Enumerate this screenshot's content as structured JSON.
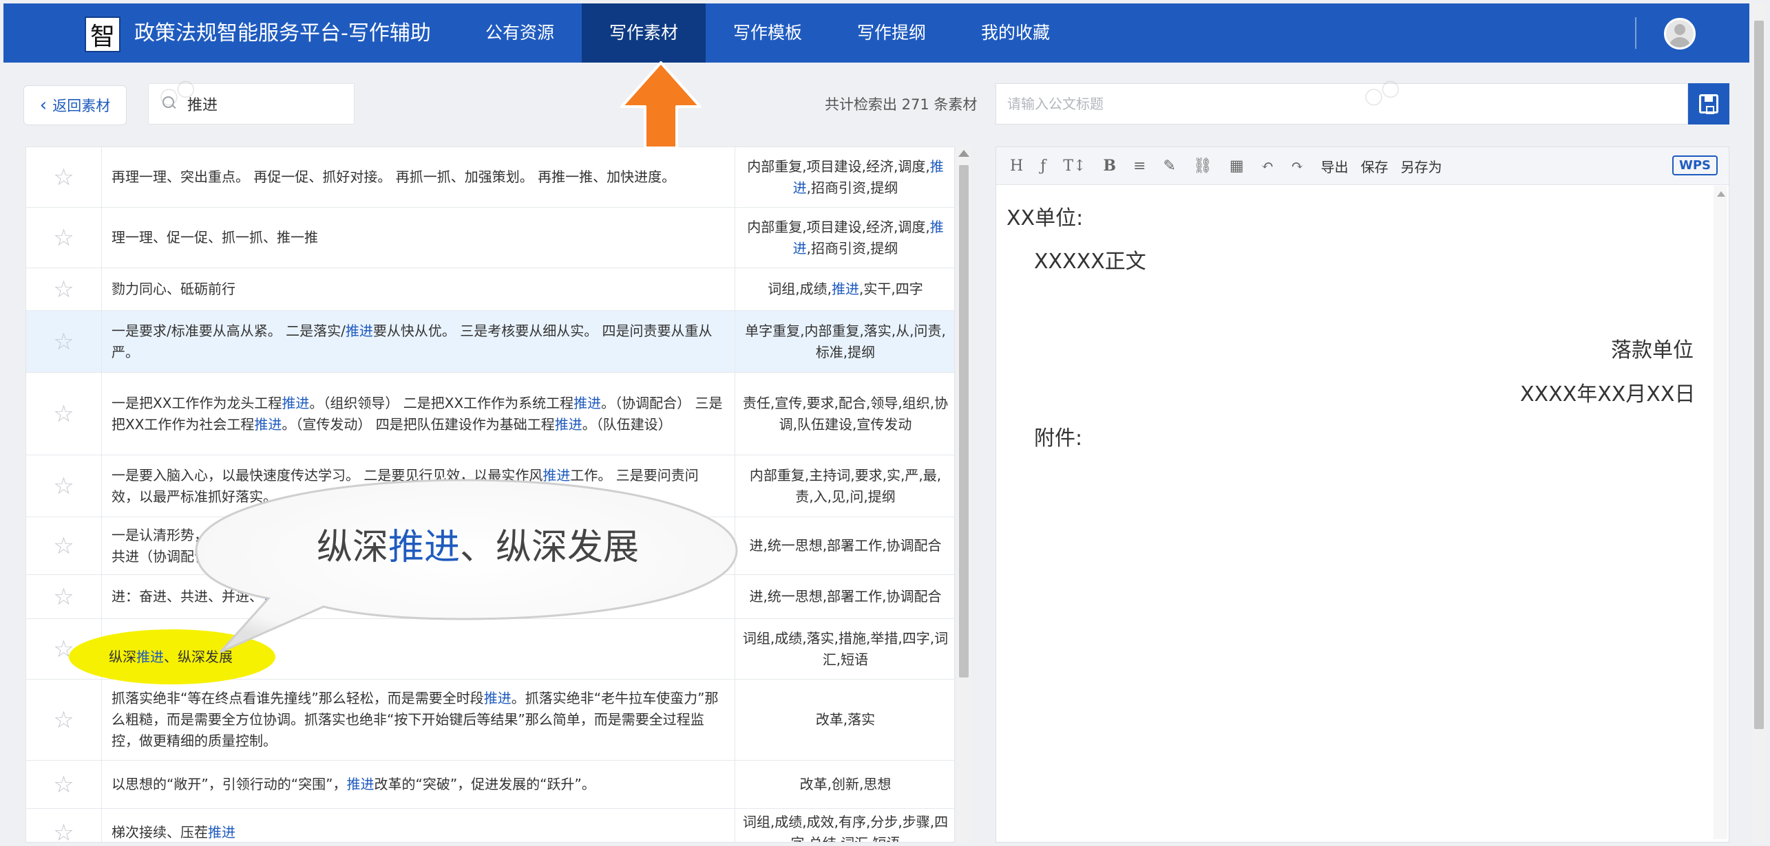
{
  "header": {
    "logo_char": "智",
    "title": "政策法规智能服务平台-写作辅助",
    "tabs": [
      {
        "label": "公有资源",
        "active": false
      },
      {
        "label": "写作素材",
        "active": true
      },
      {
        "label": "写作模板",
        "active": false
      },
      {
        "label": "写作提纲",
        "active": false
      },
      {
        "label": "我的收藏",
        "active": false
      }
    ]
  },
  "toolbar": {
    "back_label": "返回素材",
    "search_value": "推进",
    "result_count": "共计检索出 271 条素材",
    "title_placeholder": "请输入公文标题"
  },
  "materials": [
    {
      "segments": [
        {
          "t": "再理一理、突出重点。 再促一促、抓好对接。 再抓一抓、加强策划。 再推一推、加快进度。"
        }
      ],
      "tags": [
        {
          "t": "内部重复,项目建设,经济,调度,"
        },
        {
          "t": "推进",
          "hl": true
        },
        {
          "t": ",招商引资,提纲"
        }
      ],
      "starred": false
    },
    {
      "segments": [
        {
          "t": "理一理、促一促、抓一抓、推一推"
        }
      ],
      "tags": [
        {
          "t": "内部重复,项目建设,经济,调度,"
        },
        {
          "t": "推进",
          "hl": true
        },
        {
          "t": ",招商引资,提纲"
        }
      ],
      "starred": false
    },
    {
      "segments": [
        {
          "t": "勠力同心、砥砺前行"
        }
      ],
      "tags": [
        {
          "t": "词组,成绩,"
        },
        {
          "t": "推进",
          "hl": true
        },
        {
          "t": ",实干,四字"
        }
      ],
      "starred": false
    },
    {
      "segments": [
        {
          "t": "一是要求/标准要从高从紧。 二是落实/"
        },
        {
          "t": "推进",
          "hl": true
        },
        {
          "t": "要从快从优。 三是考核要从细从实。 四是问责要从重从严。"
        }
      ],
      "tags": [
        {
          "t": "单字重复,内部重复,落实,从,问责,标准,提纲"
        }
      ],
      "starred": false,
      "highlighted": true
    },
    {
      "segments": [
        {
          "t": "一是把XX工作作为龙头工程"
        },
        {
          "t": "推进",
          "hl": true
        },
        {
          "t": "。（组织领导） 二是把XX工作作为系统工程"
        },
        {
          "t": "推进",
          "hl": true
        },
        {
          "t": "。（协调配合） 三是把XX工作作为社会工程"
        },
        {
          "t": "推进",
          "hl": true
        },
        {
          "t": "。（宣传发动） 四是把队伍建设作为基础工程"
        },
        {
          "t": "推进",
          "hl": true
        },
        {
          "t": "。（队伍建设）"
        }
      ],
      "tags": [
        {
          "t": "责任,宣传,要求,配合,领导,组织,协调,队伍建设,宣传发动"
        }
      ],
      "starred": false
    },
    {
      "segments": [
        {
          "t": "一是要入脑入心，以最快速度传达学习。 二是要见行见效，以最实作风"
        },
        {
          "t": "推进",
          "hl": true
        },
        {
          "t": "工作。 三是要问责问效，以最严标准抓好落实。"
        }
      ],
      "tags": [
        {
          "t": "内部重复,主持词,要求,实,严,最,责,入,见,问,提纲"
        }
      ],
      "starred": false
    },
    {
      "segments": [
        {
          "t": "一是认清形势，提高认识，统一思想。 二是突出重点，部署工作。 三是加强协调，齐抓共管，携手共进（协调配合）"
        }
      ],
      "tags": [
        {
          "t": "进,统一思想,部署工作,协调配合"
        }
      ],
      "starred": false
    },
    {
      "segments": [
        {
          "t": "进：奋进、共进、并进、"
        },
        {
          "t": "推进",
          "hl": true
        }
      ],
      "tags": [
        {
          "t": "进,统一思想,部署工作,协调配合"
        }
      ],
      "starred": false
    },
    {
      "segments": [
        {
          "t": "纵深"
        },
        {
          "t": "推进",
          "hl": true
        },
        {
          "t": "、纵深发展"
        }
      ],
      "tags": [
        {
          "t": "词组,成绩,落实,措施,举措,四字,词汇,短语"
        }
      ],
      "starred": false
    },
    {
      "segments": [
        {
          "t": "抓落实绝非“等在终点看谁先撞线”那么轻松，而是需要全时段"
        },
        {
          "t": "推进",
          "hl": true
        },
        {
          "t": "。抓落实绝非“老牛拉车使蛮力”那么粗糙，而是需要全方位协调。抓落实也绝非“按下开始键后等结果”那么简单，而是需要全过程监控，做更精细的质量控制。"
        }
      ],
      "tags": [
        {
          "t": "改革,落实"
        }
      ],
      "starred": false
    },
    {
      "segments": [
        {
          "t": "以思想的“敞开”，引领行动的“突围”，"
        },
        {
          "t": "推进",
          "hl": true
        },
        {
          "t": "改革的“突破”，促进发展的“跃升”。"
        }
      ],
      "tags": [
        {
          "t": "改革,创新,思想"
        }
      ],
      "starred": false
    },
    {
      "segments": [
        {
          "t": "梯次接续、压茬"
        },
        {
          "t": "推进",
          "hl": true
        }
      ],
      "tags": [
        {
          "t": "词组,成绩,成效,有序,分步,步骤,四字,总结,词汇,短语"
        }
      ],
      "starred": false
    }
  ],
  "editor": {
    "tools": [
      "H",
      "ƒ",
      "T↕",
      "B",
      "≡",
      "✎",
      "⛓",
      "▦",
      "↶",
      "↷"
    ],
    "text_actions": [
      "导出",
      "保存",
      "另存为"
    ],
    "wps_label": "WPS",
    "doc": {
      "addressee": "XX单位:",
      "body": "XXXXX正文",
      "signature": "落款单位",
      "date": "XXXX年XX月XX日",
      "attachment": "附件:"
    }
  },
  "annotation": {
    "callout_segments": [
      {
        "t": "纵深"
      },
      {
        "t": "推进",
        "hl": true
      },
      {
        "t": "、纵深发展"
      }
    ],
    "highlight_segments": [
      {
        "t": "纵深"
      },
      {
        "t": "推进",
        "hl": true
      },
      {
        "t": "、纵深发展"
      }
    ]
  },
  "colors": {
    "brand": "#1f5bbf",
    "keyword": "#1f5bbf",
    "arrow": "#f57c1f",
    "marker": "#f6f100"
  }
}
